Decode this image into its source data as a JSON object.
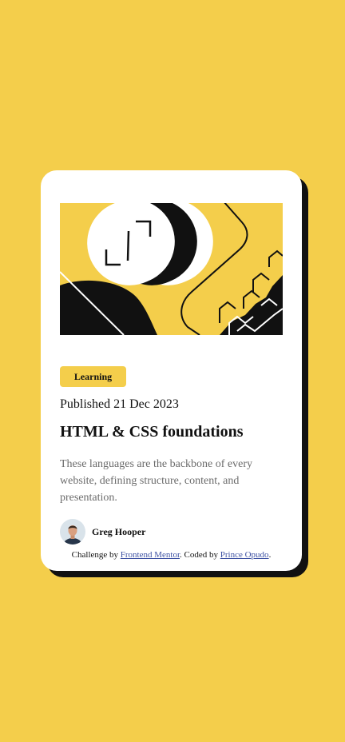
{
  "card": {
    "tag": "Learning",
    "published": "Published 21 Dec 2023",
    "title": "HTML & CSS foundations",
    "description": "These languages are the backbone of every website, defining structure, content, and presentation.",
    "author": {
      "name": "Greg Hooper"
    }
  },
  "attribution": {
    "challenge_prefix": "Challenge by ",
    "challenge_link": "Frontend Mentor",
    "coded_prefix": ". Coded by ",
    "coded_link": "Prince Opudo",
    "suffix": "."
  },
  "colors": {
    "background": "#F4CE4B",
    "card": "#FFFFFF",
    "shadow": "#111111",
    "text_muted": "#6B6B6B",
    "link": "#3E52A3"
  }
}
